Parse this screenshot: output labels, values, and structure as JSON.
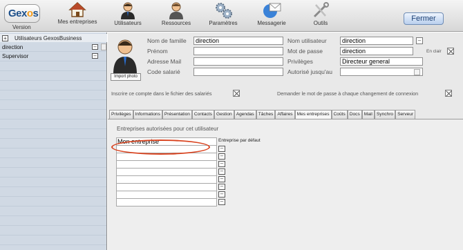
{
  "toolbar": {
    "logo_text_a": "Gex",
    "logo_text_b": "o",
    "logo_text_c": "s",
    "version_label": "Version",
    "items": [
      {
        "label": "Mes entreprises",
        "icon": "house-icon"
      },
      {
        "label": "Utilisateurs",
        "icon": "user-icon"
      },
      {
        "label": "Ressources",
        "icon": "person-icon"
      },
      {
        "label": "Paramètres",
        "icon": "gears-icon"
      },
      {
        "label": "Messagerie",
        "icon": "mail-icon"
      },
      {
        "label": "Outils",
        "icon": "tools-icon"
      }
    ],
    "close_label": "Fermer"
  },
  "sidebar": {
    "title": "Utilisateurs GexosBusiness",
    "expand_symbol": "+",
    "remove_symbol": "–",
    "users": [
      {
        "label": "direction"
      },
      {
        "label": "Supervisor"
      }
    ]
  },
  "form": {
    "import_photo_label": "Import photo",
    "labels": {
      "nom_famille": "Nom de famille",
      "prenom": "Prénom",
      "adresse_mail": "Adresse Mail",
      "code_salarie": "Code salarié",
      "nom_utilisateur": "Nom utilisateur",
      "mot_de_passe": "Mot de passe",
      "privileges": "Privilèges",
      "autorise_jusqu": "Autorisé jusqu'au",
      "en_clair": "En clair"
    },
    "values": {
      "nom_famille": "direction",
      "prenom": "",
      "adresse_mail": "",
      "code_salarie": "",
      "nom_utilisateur": "direction",
      "mot_de_passe": "direction",
      "privileges": "Directeur general",
      "autorise_jusqu": ""
    },
    "remove_symbol": "–",
    "option_inscrire": "Inscrire ce compte dans le fichier des salariés",
    "option_demander": "Demander le mot de passe à chaque changement de connexion"
  },
  "tabs": [
    {
      "label": "Privilèges"
    },
    {
      "label": "Informations"
    },
    {
      "label": "Présentation"
    },
    {
      "label": "Contacts"
    },
    {
      "label": "Gestion"
    },
    {
      "label": "Agendas"
    },
    {
      "label": "Tâches"
    },
    {
      "label": "Affaires"
    },
    {
      "label": "Mes entreprises",
      "active": true
    },
    {
      "label": "Coûts"
    },
    {
      "label": "Docs"
    },
    {
      "label": "Mail"
    },
    {
      "label": "Synchro"
    },
    {
      "label": "Serveur"
    }
  ],
  "mes_entreprises": {
    "title": "Entreprises autorisées pour cet utilisateur",
    "default_label": "Entreprise par défaut",
    "remove_symbol": "–",
    "rows": [
      "Mon entreprise",
      "",
      "",
      "",
      "",
      "",
      "",
      "",
      ""
    ]
  },
  "colors": {
    "accent": "#1c4f8a",
    "annotation": "#d9431f",
    "sidebar_bg": "#d0d9e4"
  }
}
